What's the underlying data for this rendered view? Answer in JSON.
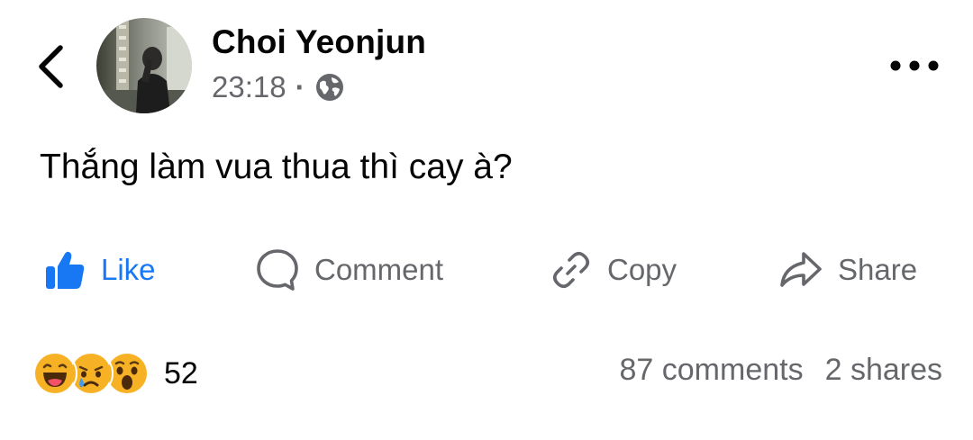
{
  "header": {
    "author_name": "Choi Yeonjun",
    "timestamp": "23:18",
    "separator": "·",
    "privacy_icon": "globe-icon",
    "back_icon": "chevron-left-icon",
    "more_icon": "more-horizontal-icon"
  },
  "post": {
    "text": "Thắng làm vua thua thì cay à?"
  },
  "actions": [
    {
      "label": "Like",
      "icon": "thumbs-up-icon",
      "color": "#1877f2"
    },
    {
      "label": "Comment",
      "icon": "comment-bubble-icon"
    },
    {
      "label": "Copy",
      "icon": "link-icon"
    },
    {
      "label": "Share",
      "icon": "share-arrow-icon"
    }
  ],
  "footer": {
    "reaction_icons": [
      "haha-reaction-icon",
      "sad-reaction-icon",
      "wow-reaction-icon"
    ],
    "reaction_count": "52",
    "comments": "87 comments",
    "shares": "2 shares"
  },
  "colors": {
    "accent": "#1877f2",
    "secondary_text": "#65676b",
    "primary_text": "#050505",
    "reaction_yellow": "#f7b125"
  }
}
